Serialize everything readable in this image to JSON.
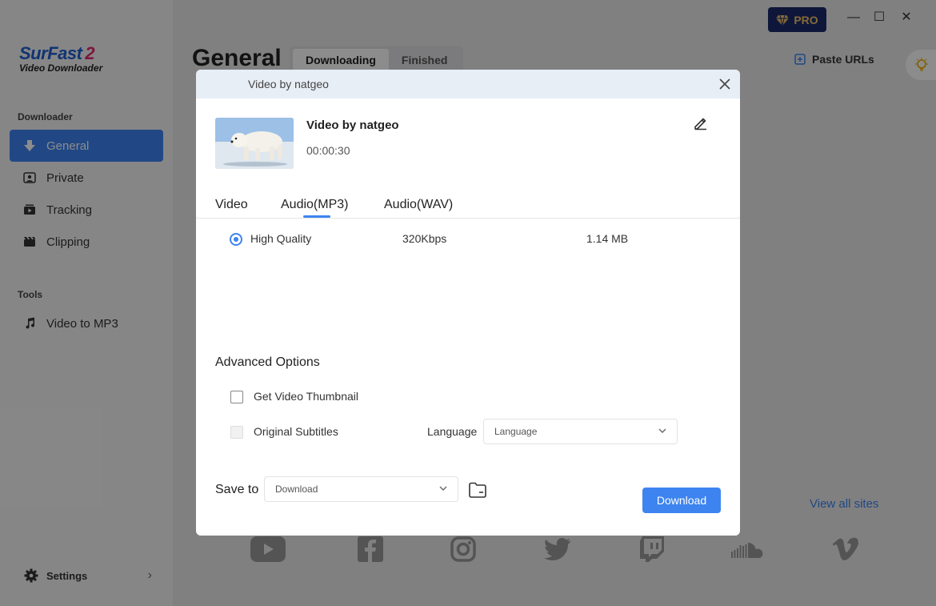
{
  "app": {
    "logo_main": "SurFast",
    "logo_num": "2",
    "logo_sub": "Video Downloader",
    "pro_label": "PRO",
    "win_min": "—",
    "win_max": "☐",
    "win_close": "✕"
  },
  "sidebar": {
    "section_downloader": "Downloader",
    "items": [
      {
        "label": "General",
        "icon": "download-arrow-icon"
      },
      {
        "label": "Private",
        "icon": "private-icon"
      },
      {
        "label": "Tracking",
        "icon": "tracking-icon"
      },
      {
        "label": "Clipping",
        "icon": "clipping-icon"
      }
    ],
    "section_tools": "Tools",
    "tools": [
      {
        "label": "Video to MP3",
        "icon": "music-note-icon"
      }
    ],
    "settings_label": "Settings",
    "settings_chev": "›"
  },
  "main": {
    "title": "General",
    "tabs": [
      {
        "label": "Downloading",
        "active": true
      },
      {
        "label": "Finished",
        "active": false
      }
    ],
    "paste_urls": "Paste URLs",
    "view_all_sites": "View all sites",
    "sites": [
      "youtube-icon",
      "facebook-icon",
      "instagram-icon",
      "twitter-icon",
      "twitch-icon",
      "soundcloud-icon",
      "vimeo-icon"
    ]
  },
  "dialog": {
    "header_title": "Video by natgeo",
    "video_title": "Video by natgeo",
    "duration": "00:00:30",
    "format_tabs": [
      "Video",
      "Audio(MP3)",
      "Audio(WAV)"
    ],
    "active_tab": "Audio(MP3)",
    "quality": {
      "label": "High Quality",
      "bitrate": "320Kbps",
      "size": "1.14 MB",
      "selected": true
    },
    "advanced_title": "Advanced Options",
    "thumbnail_label": "Get Video Thumbnail",
    "subtitles_label": "Original Subtitles",
    "language_label": "Language",
    "language_value": "Language",
    "save_to_label": "Save to",
    "save_to_value": "Download",
    "download_button": "Download"
  },
  "colors": {
    "accent": "#3d84f0",
    "pro_bg": "#1b2a6b",
    "pro_text": "#f2c26b",
    "logo_blue": "#1e5fd1",
    "logo_pink": "#e0296b"
  }
}
